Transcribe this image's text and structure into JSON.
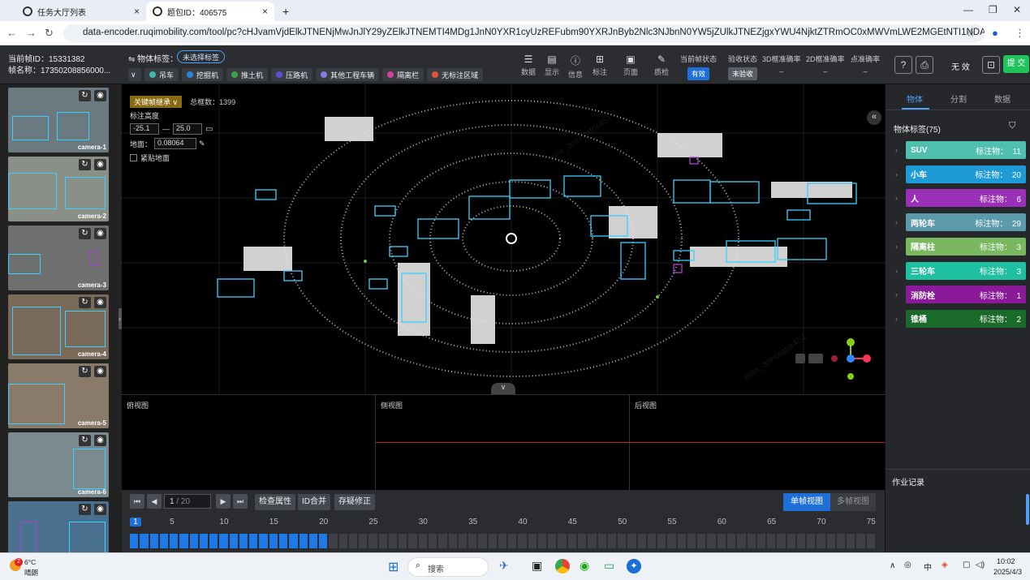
{
  "browser": {
    "tabs": [
      {
        "label": "任务大厅列表"
      },
      {
        "label": "题包ID：406575"
      }
    ],
    "new_tab": "+",
    "url": "data-encoder.ruqimobility.com/tool/pc?cHJvamVjdElkJTNENjMwJnJlY29yZElkJTNEMTI4MDg1JnN0YXR1cyUzREFubm90YXRJnByb2Nlc3NJbnN0YW5jZUlkJTNEZjgxYWU4NjktZTRmOC0xMWVmLWE2MGEtNTI1NDAwYzg2MzM0JnRhc2tEZWZpb..."
  },
  "header": {
    "frame_id_label": "当前帧ID：",
    "frame_id": "15331382",
    "frame_name_label": "帧名称：",
    "frame_name": "17350208856000...",
    "object_label_title": "物体标签：",
    "object_label_value": "未选择标签",
    "chips": [
      {
        "label": "吊车",
        "color": "#3fb8a8"
      },
      {
        "label": "挖掘机",
        "color": "#2b86d6"
      },
      {
        "label": "推土机",
        "color": "#3aa34a"
      },
      {
        "label": "压路机",
        "color": "#5a4fd6"
      },
      {
        "label": "其他工程车辆",
        "color": "#8a7ae0"
      },
      {
        "label": "隔离栏",
        "color": "#d83ea0"
      },
      {
        "label": "无标注区域",
        "color": "#e0553a"
      }
    ],
    "tools": [
      {
        "label": "数据",
        "icon": "database-icon",
        "glyph": "☰"
      },
      {
        "label": "显示",
        "icon": "display-icon",
        "glyph": "▤"
      },
      {
        "label": "信息",
        "icon": "info-icon",
        "glyph": "ⓘ"
      },
      {
        "label": "标注",
        "icon": "annotate-icon",
        "glyph": "⊞"
      },
      {
        "label": "页面",
        "icon": "page-icon",
        "glyph": "▣"
      },
      {
        "label": "质检",
        "icon": "qc-icon",
        "glyph": "✎"
      }
    ],
    "status": [
      {
        "label": "当前帧状态",
        "badge": "有效",
        "badge_color": "#1e6fd9"
      },
      {
        "label": "验收状态",
        "badge": "未验收",
        "badge_color": "#5a5d63"
      },
      {
        "label": "3D框准确率",
        "value": "–"
      },
      {
        "label": "2D框准确率",
        "value": "–"
      },
      {
        "label": "点准确率",
        "value": "–"
      }
    ],
    "help": "?",
    "invalid_label": "无 效",
    "submit_label": "提 交"
  },
  "cameras": [
    {
      "label": "camera-1",
      "bg": "#6a7a80"
    },
    {
      "label": "camera-2",
      "bg": "#8a8f88"
    },
    {
      "label": "camera-3",
      "bg": "#6e7070"
    },
    {
      "label": "camera-4",
      "bg": "#7a6a5a"
    },
    {
      "label": "camera-5",
      "bg": "#8a7a6a"
    },
    {
      "label": "camera-6",
      "bg": "#7a8a8e"
    },
    {
      "label": "camera-7",
      "bg": "#4a7090"
    }
  ],
  "viewer": {
    "keyframe_btn": "关键帧继承 ∨",
    "total_label": "总框数：",
    "total": "1399",
    "height_label": "标注高度",
    "h_min": "-25.1",
    "h_max": "25.0",
    "ground_label": "地面：",
    "ground_val": "0.08064",
    "tight_ground": "紧贴地面",
    "collapse": "«"
  },
  "views": {
    "top": "俯视图",
    "side": "侧视图",
    "back": "后视图"
  },
  "player": {
    "page_current": "1",
    "page_total": "/ 20",
    "check_attr": "检查属性",
    "id_merge": "ID合并",
    "doubt_fix": "存疑修正",
    "single_view": "单帧视图",
    "multi_view": "多帧视图",
    "ticks": [
      "1",
      "5",
      "10",
      "15",
      "20",
      "25",
      "30",
      "35",
      "40",
      "45",
      "50",
      "55",
      "60",
      "65",
      "70",
      "75"
    ],
    "filled_cells": 20,
    "total_cells": 75
  },
  "right": {
    "tabs": [
      "物体",
      "分割",
      "数据"
    ],
    "list_title": "物体标签(75)",
    "labels": [
      {
        "name": "SUV",
        "count_label": "标注物：",
        "count": "11",
        "color": "#4fc0b0"
      },
      {
        "name": "小车",
        "count_label": "标注物：",
        "count": "20",
        "color": "#1e9ad6"
      },
      {
        "name": "人",
        "count_label": "标注物：",
        "count": "6",
        "color": "#9a2fb8"
      },
      {
        "name": "两轮车",
        "count_label": "标注物：",
        "count": "29",
        "color": "#5a9aaa"
      },
      {
        "name": "隔离柱",
        "count_label": "标注物：",
        "count": "3",
        "color": "#7ab860"
      },
      {
        "name": "三轮车",
        "count_label": "标注物：",
        "count": "3",
        "color": "#1ec0a0"
      },
      {
        "name": "消防栓",
        "count_label": "标注物：",
        "count": "1",
        "color": "#8a1a9a"
      },
      {
        "name": "锥桶",
        "count_label": "标注物：",
        "count": "2",
        "color": "#1a6a2a"
      }
    ],
    "worklog": "作业记录"
  },
  "taskbar": {
    "weather_temp": "6°C",
    "weather_text": "晴朗",
    "search": "搜索",
    "time": "10:02",
    "date": "2025/4/3",
    "ime": "中"
  }
}
